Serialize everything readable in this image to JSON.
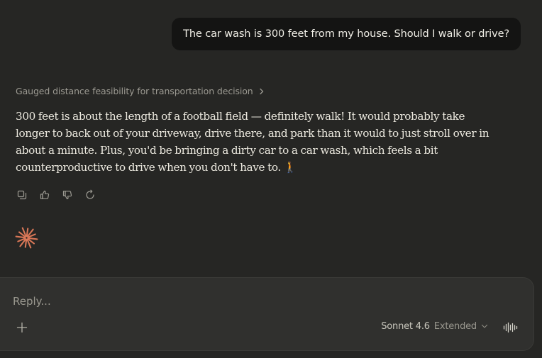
{
  "user_message": {
    "text": "The car wash is 300 feet from my house. Should I walk or drive?"
  },
  "assistant": {
    "thinking_summary": "Gauged distance feasibility for transportation decision",
    "response": "300 feet is about the length of a football field — definitely walk! It would probably take longer to back out of your driveway, drive there, and park than it would to just stroll over in about a minute. Plus, you'd be bringing a dirty car to a car wash, which feels a bit counterproductive to drive when you don't have to. 🚶",
    "actions": [
      {
        "icon": "copy-icon"
      },
      {
        "icon": "thumbs-up-icon"
      },
      {
        "icon": "thumbs-down-icon"
      },
      {
        "icon": "retry-icon"
      }
    ],
    "logo_color": "#d97757"
  },
  "composer": {
    "placeholder": "Reply...",
    "value": "",
    "model_name": "Sonnet 4.6",
    "model_mode": "Extended"
  },
  "colors": {
    "background": "#262624",
    "user_bubble": "#141413",
    "composer": "#30302e",
    "accent": "#d97757"
  }
}
